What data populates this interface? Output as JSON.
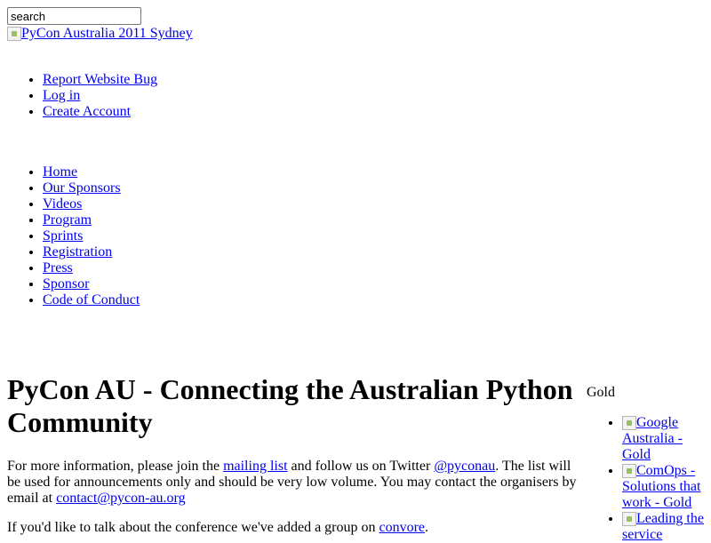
{
  "search": {
    "value": "search"
  },
  "logo": {
    "alt": "PyCon Australia 2011 Sydney"
  },
  "user_nav": [
    {
      "label": "Report Website Bug"
    },
    {
      "label": "Log in"
    },
    {
      "label": "Create Account"
    }
  ],
  "main_nav": [
    {
      "label": "Home"
    },
    {
      "label": "Our Sponsors"
    },
    {
      "label": "Videos"
    },
    {
      "label": "Program"
    },
    {
      "label": "Sprints"
    },
    {
      "label": "Registration"
    },
    {
      "label": "Press"
    },
    {
      "label": "Sponsor"
    },
    {
      "label": "Code of Conduct"
    }
  ],
  "main": {
    "title": "PyCon AU - Connecting the Australian Python Community",
    "intro": {
      "t1": "For more information, please join the ",
      "link1": "mailing list",
      "t2": " and follow us on Twitter ",
      "link2": "@pyconau",
      "t3": ". The list will be used for announcements only and should be very low volume. You may contact the organisers by email at ",
      "link3": "contact@pycon-au.org"
    },
    "intro2": {
      "t1": "If you'd like to talk about the conference we've added a group on ",
      "link1": "convore",
      "t2": "."
    }
  },
  "sponsors": {
    "heading": "Gold",
    "items": [
      {
        "alt": "Google Australia - Gold"
      },
      {
        "alt": "ComOps - Solutions that work - Gold"
      },
      {
        "alt": "Leading the service"
      }
    ]
  }
}
